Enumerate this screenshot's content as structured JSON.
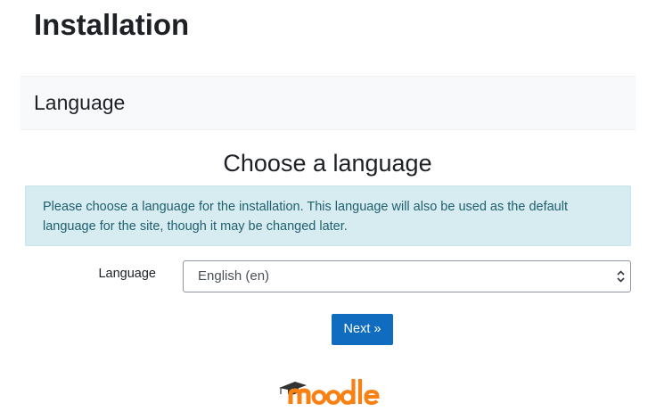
{
  "page": {
    "title": "Installation"
  },
  "section": {
    "heading": "Language"
  },
  "main": {
    "heading": "Choose a language",
    "info_text": "Please choose a language for the installation. This language will also be used as the default language for the site, though it may be changed later."
  },
  "form": {
    "language_label": "Language",
    "language_selected": "English (en)",
    "next_label": "Next »"
  },
  "logo": {
    "text": "moodle",
    "colors": {
      "m": "#f98012",
      "rest": "#f98012",
      "cap": "#333333"
    }
  },
  "colors": {
    "primary": "#0f6cbf",
    "info_bg": "#d7ecf0",
    "info_text": "#1f5f6e",
    "section_bg": "#f8f9fa"
  }
}
